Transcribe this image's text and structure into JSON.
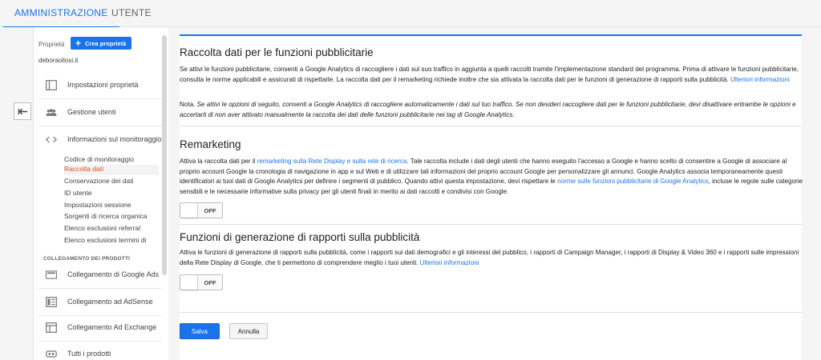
{
  "tabs": {
    "admin": "AMMINISTRAZIONE",
    "user": "UTENTE"
  },
  "sidebar": {
    "property_label": "Proprietà",
    "create_property": "Crea proprietà",
    "domain": "deboraoliosi.it",
    "items": [
      {
        "label": "Impostazioni proprietà",
        "icon": "property-settings-icon"
      },
      {
        "label": "Gestione utenti",
        "icon": "users-icon"
      },
      {
        "label": "Informazioni sul monitoraggio",
        "icon": "code-icon"
      }
    ],
    "subitems": [
      "Codice di monitoraggio",
      "Raccolta dati",
      "Conservazione dei dati",
      "ID utente",
      "Impostazioni sessione",
      "Sorgenti di ricerca organica",
      "Elenco esclusioni referral",
      "Elenco esclusioni termini di"
    ],
    "active_subitem": "Raccolta dati",
    "section_title": "COLLEGAMENTO DEI PRODOTTI",
    "product_links": [
      {
        "label": "Collegamento di Google Ads",
        "icon": "google-ads-icon"
      },
      {
        "label": "Collegamento ad AdSense",
        "icon": "adsense-icon"
      },
      {
        "label": "Collegamento Ad Exchange",
        "icon": "ad-exchange-icon"
      },
      {
        "label": "Tutti i prodotti",
        "icon": "all-products-icon"
      }
    ]
  },
  "main": {
    "section1": {
      "title": "Raccolta dati per le funzioni pubblicitarie",
      "para1": "Se attivi le funzioni pubblicitarie, consenti a Google Analytics di raccogliere i dati sul suo traffico in aggiunta a quelli raccolti tramite l'implementazione standard del programma. Prima di attivare le funzioni pubblicitarie, consulta le norme applicabili e assicurati di rispettarle. La raccolta dati per il remarketing richiede inoltre che sia attivata la raccolta dati per le funzioni di generazione di rapporti sulla pubblicità.",
      "link1": "Ulteriori informazioni",
      "note_label": "Nota.",
      "note_text": "Se attivi le opzioni di seguito, consenti a Google Analytics di raccogliere automaticamente i dati sul tuo traffico. Se non desideri raccogliere dati per le funzioni pubblicitarie, devi disattivare entrambe le opzioni e accertarti di non aver attivato manualmente la raccolta dei dati delle funzioni pubblicitarie nei tag di Google Analytics."
    },
    "section2": {
      "title": "Remarketing",
      "text_a": "Attiva la raccolta dati per il",
      "link_a": "remarketing sulla Rete Display e sulla rete di ricerca",
      "text_b": ". Tale raccolta include i dati degli utenti che hanno eseguito l'accesso a Google e hanno scelto di consentire a Google di associare al proprio account Google la cronologia di navigazione in app e sul Web e di utilizzare tali informazioni del proprio account Google per personalizzare gli annunci. Google Analytics associa temporaneamente questi identificatori ai tuoi dati di Google Analytics per definire i segmenti di pubblico. Quando attivi questa impostazione, devi rispettare le",
      "link_b": "norme sulle funzioni pubblicitarie di Google Analytics",
      "text_c": ", incluse le regole sulle categorie sensibili e le necessarie informative sulla privacy per gli utenti finali in merito ai dati raccolti e condivisi con Google.",
      "toggle": "OFF"
    },
    "section3": {
      "title": "Funzioni di generazione di rapporti sulla pubblicità",
      "text": "Attiva le funzioni di generazione di rapporti sulla pubblicità, come i rapporti sui dati demografici e gli interessi del pubblico, i rapporti di Campaign Manager, i rapporti di Display & Video 360 e i rapporti sulle impressioni della Rete Display di Google, che ti permettono di comprendere meglio i tuoi utenti.",
      "link": "Ulteriori informazioni",
      "toggle": "OFF"
    },
    "buttons": {
      "save": "Salva",
      "cancel": "Annulla"
    }
  },
  "colors": {
    "accent": "#1a73e8",
    "active_subitem": "#e64a19"
  }
}
